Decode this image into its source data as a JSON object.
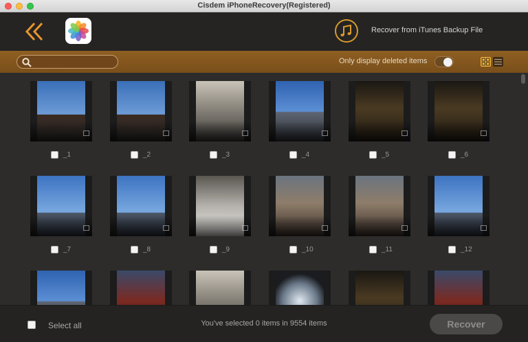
{
  "window": {
    "title": "Cisdem iPhoneRecovery(Registered)"
  },
  "header": {
    "back_icon": "double-chevron-left-icon",
    "app_icon": "photos-app-icon",
    "itunes_icon": "music-note-icon",
    "itunes_label": "Recover from iTunes Backup File"
  },
  "toolbar": {
    "search_placeholder": "",
    "search_value": "",
    "only_deleted_label": "Only display deleted items",
    "only_deleted_on": false,
    "view_mode": "grid"
  },
  "items": [
    {
      "label": "_1",
      "scene": "pagoda"
    },
    {
      "label": "_2",
      "scene": "pagoda"
    },
    {
      "label": "_3",
      "scene": "building"
    },
    {
      "label": "_4",
      "scene": "skyline"
    },
    {
      "label": "_5",
      "scene": "night"
    },
    {
      "label": "_6",
      "scene": "night"
    },
    {
      "label": "_7",
      "scene": "tower"
    },
    {
      "label": "_8",
      "scene": "tower"
    },
    {
      "label": "_9",
      "scene": "crowd"
    },
    {
      "label": "_10",
      "scene": "street"
    },
    {
      "label": "_11",
      "scene": "street"
    },
    {
      "label": "_12",
      "scene": "tower"
    },
    {
      "label": "",
      "scene": "skyline"
    },
    {
      "label": "",
      "scene": "gate"
    },
    {
      "label": "",
      "scene": "building"
    },
    {
      "label": "",
      "scene": "fisheye"
    },
    {
      "label": "",
      "scene": "night"
    },
    {
      "label": "",
      "scene": "gate"
    }
  ],
  "footer": {
    "select_all_label": "Select all",
    "status_text": "You've selected 0 items in 9554 items",
    "recover_label": "Recover"
  },
  "colors": {
    "accent": "#d89a2c",
    "toolbar_band": "#7a4f1a",
    "background": "#2d2c2b"
  }
}
